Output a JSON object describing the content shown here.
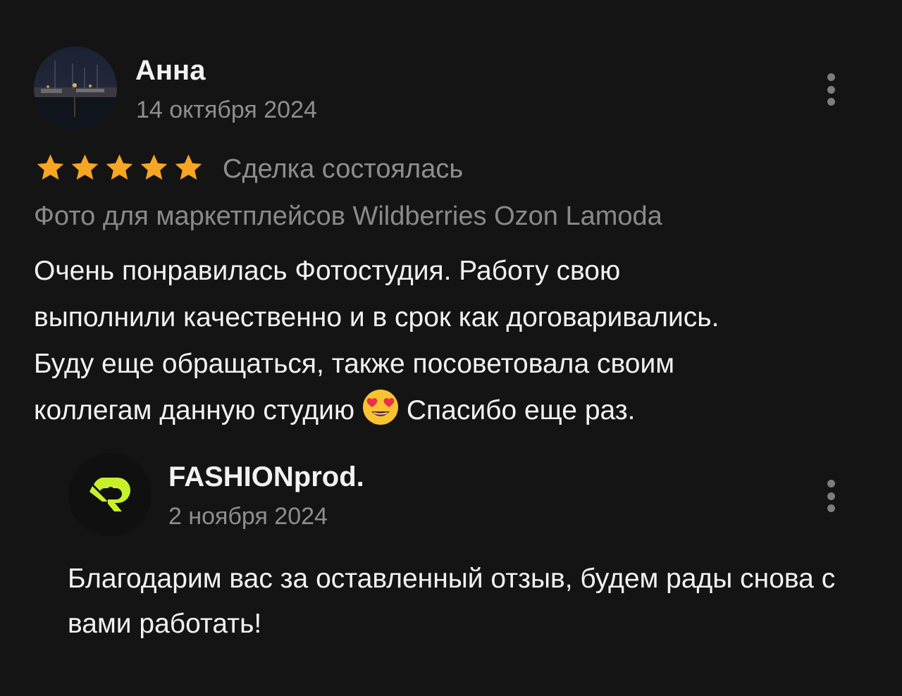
{
  "review": {
    "author": "Анна",
    "date": "14 октября 2024",
    "rating": 5,
    "rating_max": 5,
    "deal_status": "Сделка состоялась",
    "service": "Фото для маркетплейсов Wildberries Ozon Lamoda",
    "text_lines": [
      "Очень понравилась Фотостудия. Работу свою",
      "выполнили качественно и в срок как договаривались.",
      "Буду еще обращаться, также посоветовала своим",
      "коллегам данную студию",
      "Спасибо еще раз."
    ],
    "emoji_icon": "heart-eyes-emoji-icon"
  },
  "reply": {
    "author": "FASHIONprod.",
    "date": "2 ноября 2024",
    "text": "Благодарим вас за оставленный отзыв, будем рады снова с вами работать!"
  },
  "colors": {
    "background": "#141414",
    "star": "#f6a623",
    "logo": "#c8f02a",
    "secondary_text": "#8e8e8e"
  }
}
